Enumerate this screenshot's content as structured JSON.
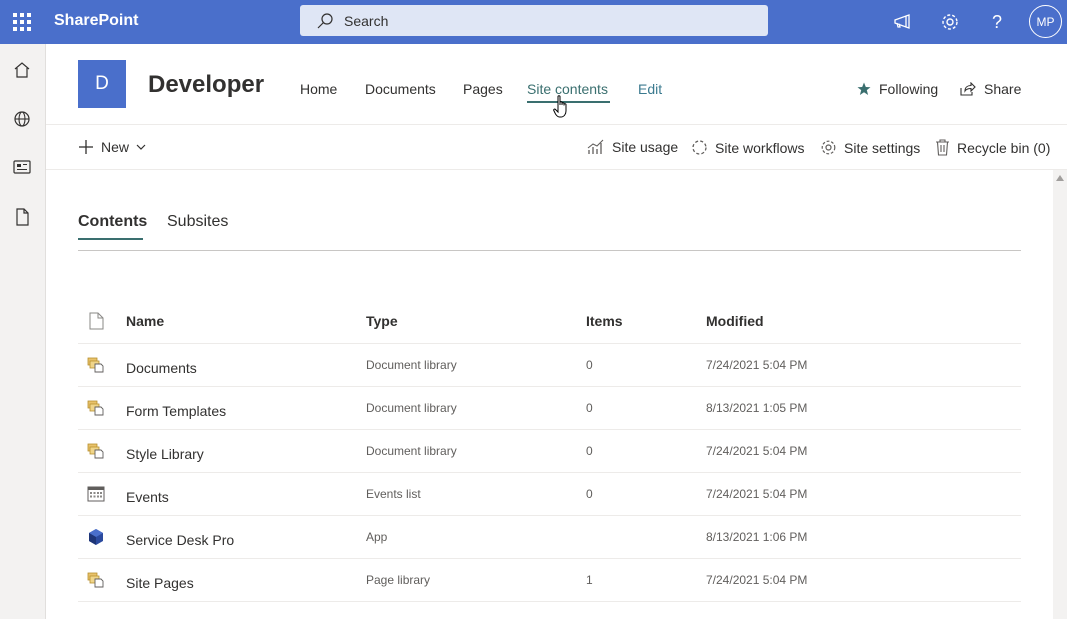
{
  "suite": {
    "brand": "SharePoint",
    "search_placeholder": "Search",
    "avatar_initials": "MP",
    "brand_color": "#4a6fcb"
  },
  "appbar": {
    "items": [
      "home-icon",
      "globe-icon",
      "news-icon",
      "file-icon"
    ]
  },
  "site": {
    "logo_letter": "D",
    "title": "Developer",
    "nav": [
      {
        "label": "Home"
      },
      {
        "label": "Documents"
      },
      {
        "label": "Pages"
      },
      {
        "label": "Site contents",
        "active": true
      },
      {
        "label": "Edit"
      }
    ],
    "following_label": "Following",
    "share_label": "Share"
  },
  "commandbar": {
    "new_label": "New",
    "site_usage": "Site usage",
    "site_workflows": "Site workflows",
    "site_settings": "Site settings",
    "recycle_bin": "Recycle bin (0)"
  },
  "pivot": {
    "tabs": [
      {
        "label": "Contents",
        "active": true
      },
      {
        "label": "Subsites"
      }
    ]
  },
  "table": {
    "headers": {
      "name": "Name",
      "type": "Type",
      "items": "Items",
      "modified": "Modified"
    },
    "rows": [
      {
        "icon": "library-icon",
        "name": "Documents",
        "type": "Document library",
        "items": "0",
        "modified": "7/24/2021 5:04 PM"
      },
      {
        "icon": "library-icon",
        "name": "Form Templates",
        "type": "Document library",
        "items": "0",
        "modified": "8/13/2021 1:05 PM"
      },
      {
        "icon": "library-icon",
        "name": "Style Library",
        "type": "Document library",
        "items": "0",
        "modified": "7/24/2021 5:04 PM"
      },
      {
        "icon": "calendar-icon",
        "name": "Events",
        "type": "Events list",
        "items": "0",
        "modified": "7/24/2021 5:04 PM"
      },
      {
        "icon": "app-icon",
        "name": "Service Desk Pro",
        "type": "App",
        "items": "",
        "modified": "8/13/2021 1:06 PM"
      },
      {
        "icon": "library-icon",
        "name": "Site Pages",
        "type": "Page library",
        "items": "1",
        "modified": "7/24/2021 5:04 PM"
      }
    ]
  }
}
